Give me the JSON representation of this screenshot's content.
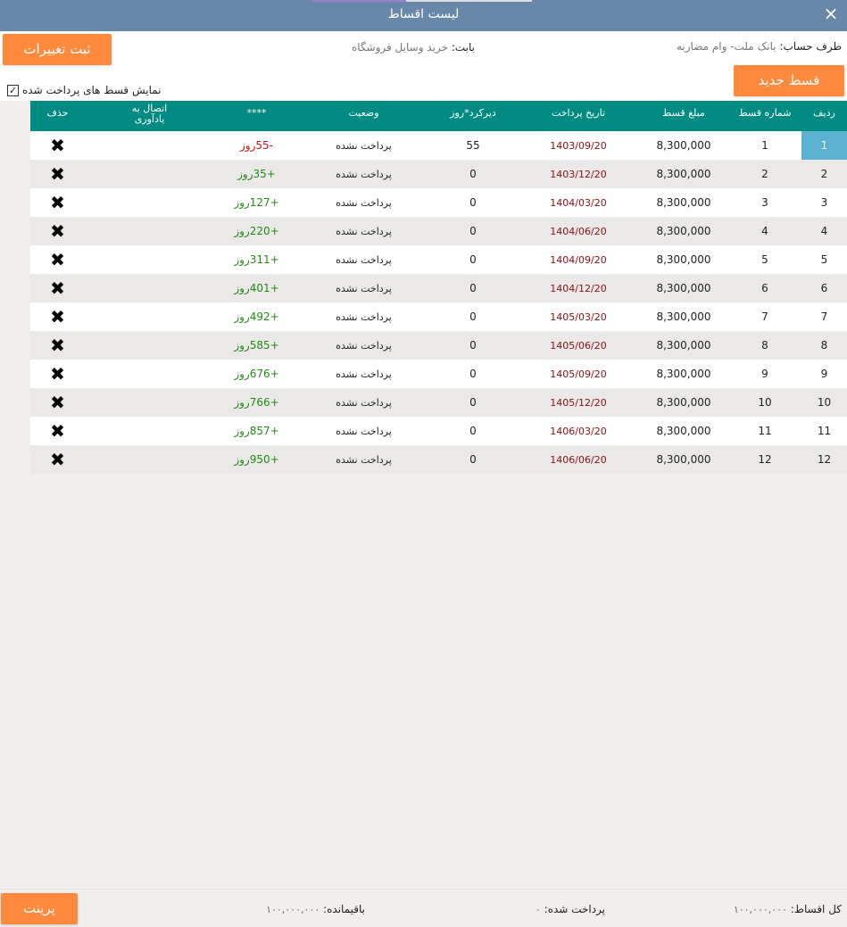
{
  "window": {
    "title": "لیست اقساط",
    "close_icon": "×"
  },
  "toolbar": {
    "save_label": "ثبت تغییرات",
    "new_label": "قسط جدید"
  },
  "account": {
    "label": "طرف حساب:",
    "value": "بانک ملت- وام مضاربه"
  },
  "subject": {
    "label": "بابت:",
    "value": "خرید وسایل فروشگاه"
  },
  "show_paid": {
    "label": "نمایش قسط های پرداخت شده",
    "checked": true,
    "check_glyph": "✓"
  },
  "columns": {
    "row": "ردیف",
    "number": "شماره قسط",
    "amount": "مبلغ قسط",
    "date": "تاریخ پرداخت",
    "delay": "دیرکرد*روز",
    "status": "وضعیت",
    "stars": "****",
    "link_line1": "اتصال به",
    "link_line2": "یادآوری",
    "delete": "حذف"
  },
  "rows": [
    {
      "row": "1",
      "number": "1",
      "amount": "8,300,000",
      "date": "1403/09/20",
      "delay": "55",
      "status": "پرداخت نشده",
      "days": "-55روز",
      "overdue": true,
      "selected": true
    },
    {
      "row": "2",
      "number": "2",
      "amount": "8,300,000",
      "date": "1403/12/20",
      "delay": "0",
      "status": "پرداخت نشده",
      "days": "+35روز",
      "overdue": false
    },
    {
      "row": "3",
      "number": "3",
      "amount": "8,300,000",
      "date": "1404/03/20",
      "delay": "0",
      "status": "پرداخت نشده",
      "days": "+127روز",
      "overdue": false
    },
    {
      "row": "4",
      "number": "4",
      "amount": "8,300,000",
      "date": "1404/06/20",
      "delay": "0",
      "status": "پرداخت نشده",
      "days": "+220روز",
      "overdue": false
    },
    {
      "row": "5",
      "number": "5",
      "amount": "8,300,000",
      "date": "1404/09/20",
      "delay": "0",
      "status": "پرداخت نشده",
      "days": "+311روز",
      "overdue": false
    },
    {
      "row": "6",
      "number": "6",
      "amount": "8,300,000",
      "date": "1404/12/20",
      "delay": "0",
      "status": "پرداخت نشده",
      "days": "+401روز",
      "overdue": false
    },
    {
      "row": "7",
      "number": "7",
      "amount": "8,300,000",
      "date": "1405/03/20",
      "delay": "0",
      "status": "پرداخت نشده",
      "days": "+492روز",
      "overdue": false
    },
    {
      "row": "8",
      "number": "8",
      "amount": "8,300,000",
      "date": "1405/06/20",
      "delay": "0",
      "status": "پرداخت نشده",
      "days": "+585روز",
      "overdue": false
    },
    {
      "row": "9",
      "number": "9",
      "amount": "8,300,000",
      "date": "1405/09/20",
      "delay": "0",
      "status": "پرداخت نشده",
      "days": "+676روز",
      "overdue": false
    },
    {
      "row": "10",
      "number": "10",
      "amount": "8,300,000",
      "date": "1405/12/20",
      "delay": "0",
      "status": "پرداخت نشده",
      "days": "+766روز",
      "overdue": false
    },
    {
      "row": "11",
      "number": "11",
      "amount": "8,300,000",
      "date": "1406/03/20",
      "delay": "0",
      "status": "پرداخت نشده",
      "days": "+857روز",
      "overdue": false
    },
    {
      "row": "12",
      "number": "12",
      "amount": "8,300,000",
      "date": "1406/06/20",
      "delay": "0",
      "status": "پرداخت نشده",
      "days": "+950روز",
      "overdue": false
    }
  ],
  "delete_icon": "✖",
  "footer": {
    "total_label": "کل اقساط:",
    "total_value": "۱۰۰,۰۰۰,۰۰۰",
    "paid_label": "پرداخت شده:",
    "paid_value": "۰",
    "remaining_label": "باقیمانده:",
    "remaining_value": "۱۰۰,۰۰۰,۰۰۰",
    "print_label": "پرینت"
  },
  "colors": {
    "titlebar": "#6788a9",
    "header": "#008b82",
    "accent_button": "#ff8a3d",
    "selected_row": "#5bb1cf",
    "overdue_text": "#c0141a",
    "upcoming_text": "#248a15",
    "date_text": "#8a0f14"
  }
}
